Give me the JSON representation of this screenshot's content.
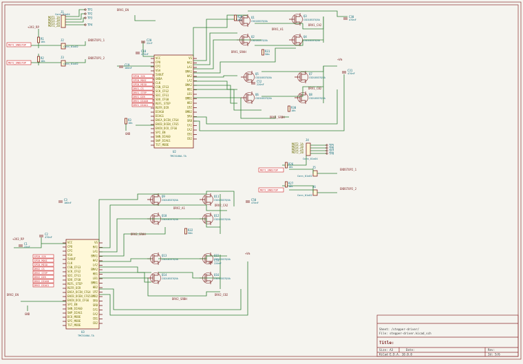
{
  "sheet": {
    "title_label": "Title:",
    "sheet_line": "Sheet: /stepper-driver/",
    "file_line": "File: stepper-driver.kicad_sch",
    "size_label": "Size: A3",
    "date_label": "Date:",
    "rev_label": "Rev:",
    "tool_label": "KiCad E.D.A. 10.0.0",
    "id_label": "Id: 5/6"
  },
  "driver_top": {
    "ref": "U2",
    "value": "TMC5160A-TA",
    "pins_left": [
      "VCC",
      "CPO",
      "CPI",
      "VSA",
      "5VOUT",
      "GNDA",
      "CLK",
      "CSN_CFG3",
      "SCK_CFG2",
      "SDI_CFG1",
      "SDO_CFG0",
      "REFL_STEP",
      "REFR_DIR",
      "DIAG0",
      "DIAG1",
      "ENCA_DCIN_CFG4",
      "ENCB_DCEN_CFG5",
      "ENCN_DCO_CFG6",
      "SPI_EN",
      "SWN_DIAG0",
      "SWP_DIAG1",
      "TST_MODE"
    ],
    "pins_right": [
      "VS",
      "HA1",
      "LA1",
      "BMA1",
      "HA2",
      "LA2",
      "BMA2",
      "HB1",
      "LB1",
      "BMB1",
      "HB2",
      "LB2",
      "BMB2",
      "SRA",
      "SRB",
      "CA1",
      "CA2",
      "CB1",
      "CB2"
    ]
  },
  "driver_bottom": {
    "ref": "U3",
    "value": "TMC5160A-TA",
    "pins_left": [
      "VCC",
      "CPO",
      "CPI",
      "VSA",
      "5VOUT",
      "CLK",
      "CSN_CFG3",
      "SCK_CFG2",
      "SDI_CFG1",
      "SDO_CFG0",
      "REFL_STEP",
      "REFR_DIR",
      "ENCA_DCIN_CFG4",
      "ENCB_DCEN_CFG5",
      "ENCN_DCO_CFG6",
      "SPI_EN",
      "SWN_DIAG0",
      "SWP_DIAG1",
      "DCO_MODE",
      "SPI_MODE",
      "TST_MODE"
    ],
    "pins_right": [
      "VS",
      "HA1",
      "LA1",
      "BMA1",
      "HA2",
      "LA2",
      "BMA2",
      "HB1",
      "LB1",
      "BMB1",
      "HB2",
      "LB2",
      "BMB2",
      "SRA",
      "SRB",
      "CA1",
      "CA2",
      "CB1",
      "CB2"
    ]
  },
  "mosfets_top": [
    {
      "ref": "Q1",
      "value": "CSD18537Q5A"
    },
    {
      "ref": "Q2",
      "value": "CSD18537Q5A"
    },
    {
      "ref": "Q3",
      "value": "CSD18537Q5A"
    },
    {
      "ref": "Q4",
      "value": "CSD18537Q5A"
    },
    {
      "ref": "Q5",
      "value": "CSD18537Q5A"
    },
    {
      "ref": "Q6",
      "value": "CSD18537Q5A"
    },
    {
      "ref": "Q7",
      "value": "CSD18537Q5A"
    },
    {
      "ref": "Q8",
      "value": "CSD18537Q5A"
    }
  ],
  "mosfets_bottom": [
    {
      "ref": "Q9",
      "value": "CSD18537Q5A"
    },
    {
      "ref": "Q10",
      "value": "CSD18537Q5A"
    },
    {
      "ref": "Q11",
      "value": "CSD18537Q5A"
    },
    {
      "ref": "Q12",
      "value": "CSD18537Q5A"
    },
    {
      "ref": "Q13",
      "value": "CSD18537Q5A"
    },
    {
      "ref": "Q14",
      "value": "CSD18537Q5A"
    },
    {
      "ref": "Q15",
      "value": "CSD18537Q5A"
    },
    {
      "ref": "Q16",
      "value": "CSD18537Q5A"
    }
  ],
  "connectors": [
    {
      "ref": "J1",
      "value": "Conn_01x04",
      "pins": [
        "MOT1_1A",
        "MOT1_1B",
        "MOT1_2A",
        "MOT1_2B"
      ]
    },
    {
      "ref": "J2",
      "value": "Conn_01x02"
    },
    {
      "ref": "J3",
      "value": "Conn_01x02"
    },
    {
      "ref": "J4",
      "value": "Conn_01x04",
      "pins": [
        "MOT2_1A",
        "MOT2_1B",
        "MOT2_2A",
        "MOT2_2B"
      ]
    },
    {
      "ref": "J5",
      "value": "Conn_01x02"
    },
    {
      "ref": "J6",
      "value": "Conn_01x02"
    }
  ],
  "net_labels": [
    "DRV1_EN",
    "DRV2_EN",
    "MOT1_ENDSTOP",
    "MOT2_ENDSTOP",
    "DRV1_SRAH",
    "DRV1_SRBH",
    "DRV2_SRAH",
    "DRV2_SRBH",
    "ENDSTOP1_1",
    "ENDSTOP1_2",
    "ENDSTOP2_1",
    "ENDSTOP2_2",
    "DRV1_CA2",
    "DRV1_CB2",
    "DRV2_CA2",
    "DRV2_CB2",
    "DRV1_A1",
    "DRV2_A1"
  ],
  "power_labels": [
    "+3V3_RP",
    "+3V3_RP",
    "+Vm",
    "+Vm",
    "GND",
    "GND"
  ],
  "spi_flags": [
    "SPI0_SCK",
    "SPI0_MOSI",
    "SPI0_MISO",
    "DRV1_CS",
    "DRV1_STEP",
    "DRV1_DIR",
    "DRV1_DIAG0",
    "DRV1_DIAG1",
    "SPI0_SCK",
    "SPI0_MOSI",
    "SPI0_MISO",
    "DRV2_CS",
    "DRV2_STEP",
    "DRV2_DIR",
    "DRV2_DIAG0",
    "DRV2_DIAG1"
  ],
  "caps": [
    {
      "ref": "C1",
      "value": "22nF"
    },
    {
      "ref": "C2",
      "value": "470nF"
    },
    {
      "ref": "C3",
      "value": "100nF"
    },
    {
      "ref": "C18",
      "value": "470nF"
    },
    {
      "ref": "C19",
      "value": "100nF"
    },
    {
      "ref": "C20",
      "value": "22nF"
    },
    {
      "ref": "C30",
      "value": "470nF"
    },
    {
      "ref": "C31",
      "value": "470nF"
    },
    {
      "ref": "C50",
      "value": "470nF"
    },
    {
      "ref": "C52",
      "value": "220nF"
    },
    {
      "ref": "C53",
      "value": "220nF"
    }
  ],
  "resistors": [
    {
      "ref": "R1",
      "value": "10k"
    },
    {
      "ref": "R2",
      "value": "10k"
    },
    {
      "ref": "R3",
      "value": "10k"
    },
    {
      "ref": "R26",
      "value": "10k"
    },
    {
      "ref": "R27",
      "value": "10k"
    },
    {
      "ref": "R29",
      "value": "10k"
    },
    {
      "ref": "R30",
      "value": "10k"
    },
    {
      "ref": "R31",
      "value": "50m"
    },
    {
      "ref": "R32",
      "value": "50m"
    }
  ],
  "testpoints": [
    "TP1",
    "TP2",
    "TP3",
    "TP4",
    "TP5",
    "TP6",
    "TP7",
    "TP8"
  ]
}
